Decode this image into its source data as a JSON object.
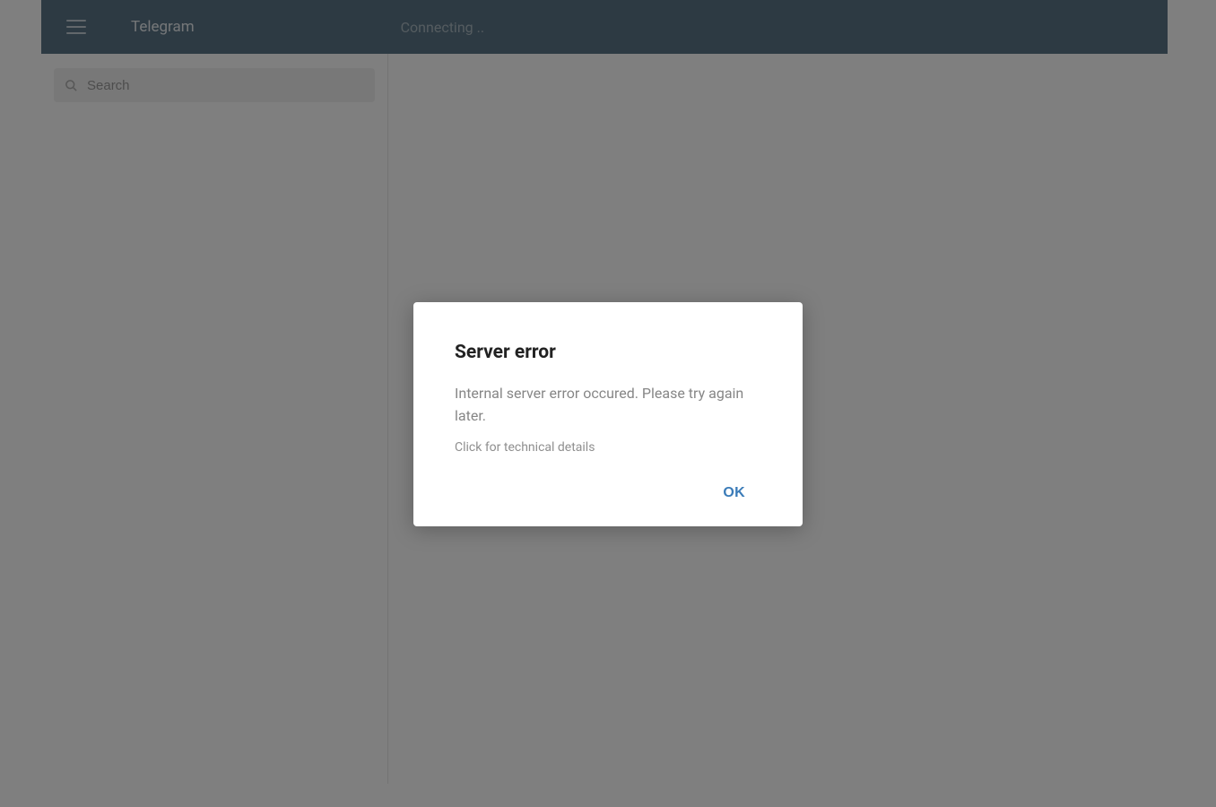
{
  "header": {
    "app_title": "Telegram",
    "status": "Connecting .."
  },
  "sidebar": {
    "search_placeholder": "Search"
  },
  "dialog": {
    "title": "Server error",
    "message": "Internal server error occured. Please try again later.",
    "details_link": "Click for technical details",
    "ok_label": "OK"
  }
}
